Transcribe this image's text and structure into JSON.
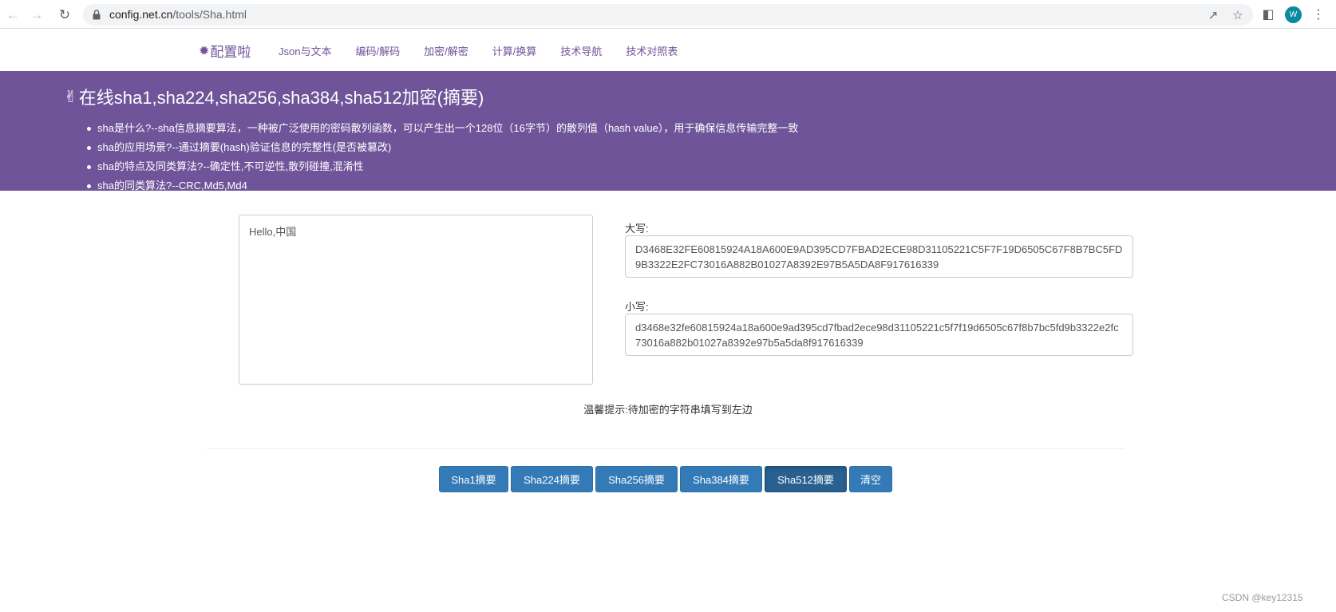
{
  "browser": {
    "url_host": "config.net.cn",
    "url_path": "/tools/Sha.html",
    "profile_initial": "W"
  },
  "site": {
    "brand": "配置啦",
    "nav": [
      "Json与文本",
      "编码/解码",
      "加密/解密",
      "计算/换算",
      "技术导航",
      "技术对照表"
    ]
  },
  "banner": {
    "title": "在线sha1,sha224,sha256,sha384,sha512加密(摘要)",
    "bullets": [
      "sha是什么?--sha信息摘要算法，一种被广泛使用的密码散列函数，可以产生出一个128位（16字节）的散列值（hash value），用于确保信息传输完整一致",
      "sha的应用场景?--通过摘要(hash)验证信息的完整性(是否被篡改)",
      "sha的特点及同类算法?--确定性,不可逆性,散列碰撞,混淆性",
      "sha的同类算法?--CRC,Md5,Md4"
    ]
  },
  "main": {
    "source_text": "Hello,中国",
    "upper_label": "大写:",
    "upper_value": "D3468E32FE60815924A18A600E9AD395CD7FBAD2ECE98D31105221C5F7F19D6505C67F8B7BC5FD9B3322E2FC73016A882B01027A8392E97B5A5DA8F917616339",
    "lower_label": "小写:",
    "lower_value": "d3468e32fe60815924a18a600e9ad395cd7fbad2ece98d31105221c5f7f19d6505c67f8b7bc5fd9b3322e2fc73016a882b01027a8392e97b5a5da8f917616339",
    "hint": "温馨提示:待加密的字符串填写到左边"
  },
  "buttons": {
    "sha1": "Sha1摘要",
    "sha224": "Sha224摘要",
    "sha256": "Sha256摘要",
    "sha384": "Sha384摘要",
    "sha512": "Sha512摘要",
    "clear": "清空"
  },
  "watermark": "CSDN @key12315",
  "colors": {
    "brand_purple": "#6f5499",
    "button_blue": "#337ab7",
    "button_active": "#286090"
  }
}
